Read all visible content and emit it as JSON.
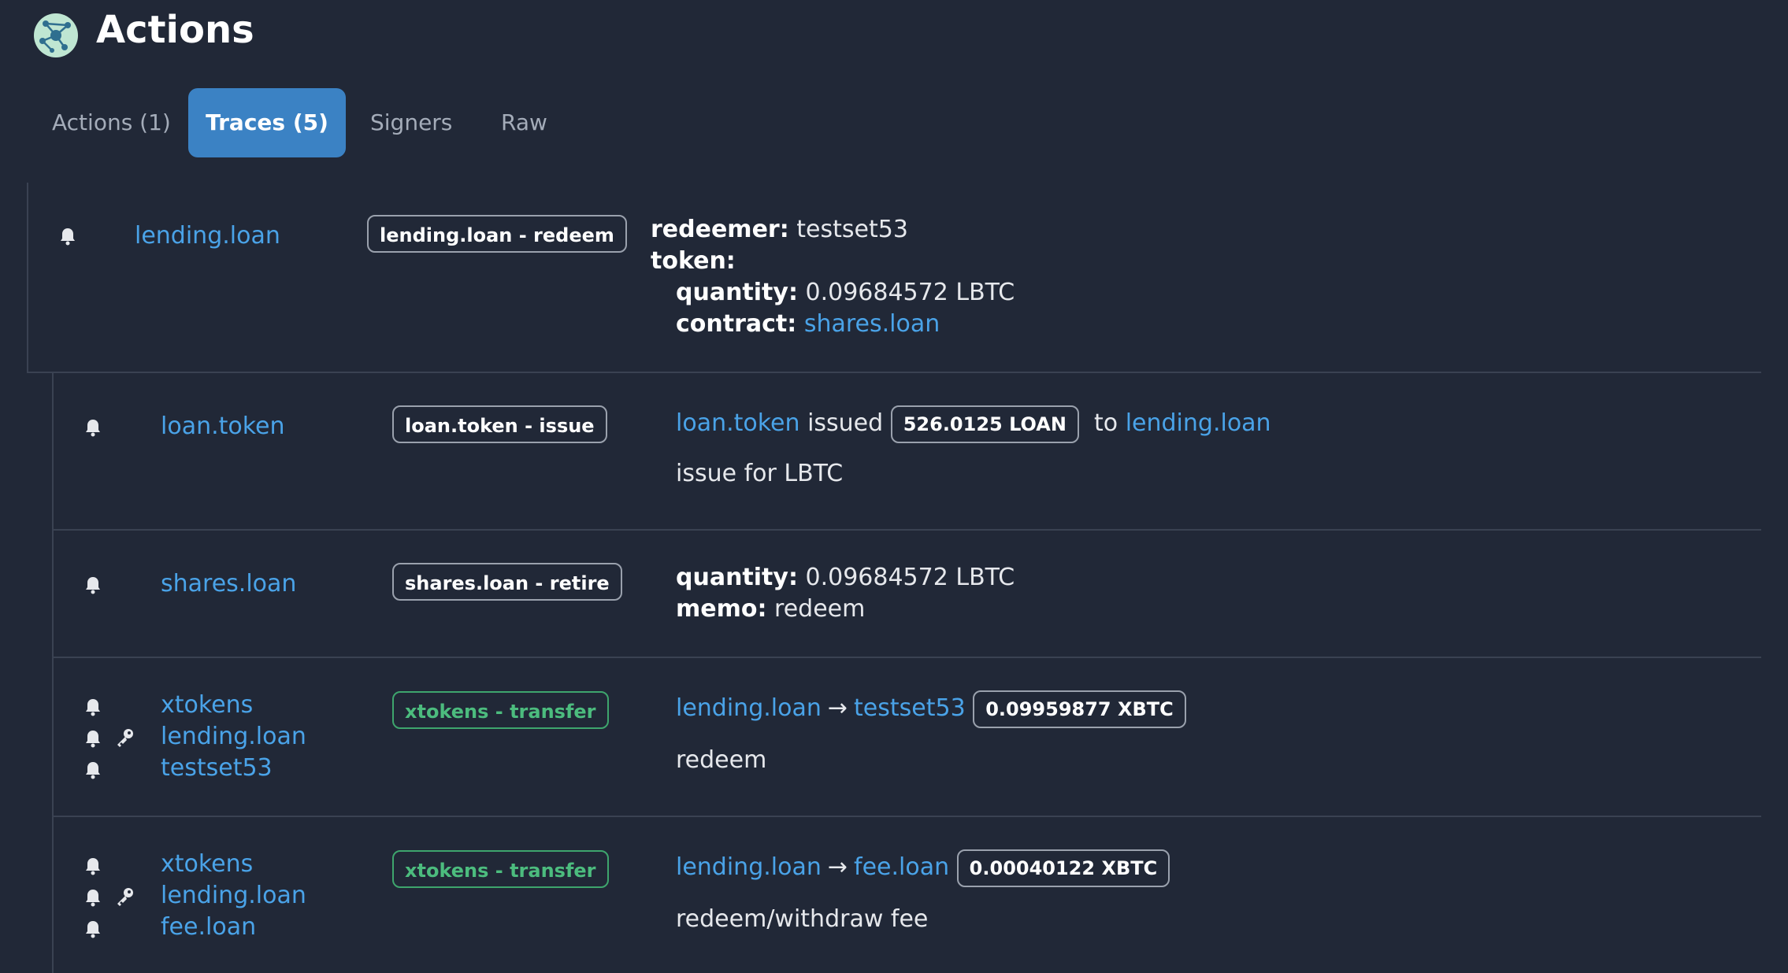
{
  "header": {
    "title": "Actions",
    "logo_icon": "network-logo-icon"
  },
  "tabs": [
    {
      "label": "Actions (1)",
      "active": false
    },
    {
      "label": "Traces (5)",
      "active": true
    },
    {
      "label": "Signers",
      "active": false
    },
    {
      "label": "Raw",
      "active": false
    }
  ],
  "colors": {
    "background": "#212837",
    "accent": "#3b82c4",
    "link": "#4aa3e8",
    "green": "#4cbc7e"
  },
  "traces": [
    {
      "accounts": [
        "lending.loan"
      ],
      "badge": "lending.loan - redeem",
      "fields": {
        "redeemer_label": "redeemer:",
        "redeemer": "testset53",
        "token_label": "token:",
        "quantity_label": "quantity:",
        "quantity": "0.09684572 LBTC",
        "contract_label": "contract:",
        "contract": "shares.loan"
      }
    },
    {
      "accounts": [
        "loan.token"
      ],
      "badge": "loan.token - issue",
      "issuer": "loan.token",
      "verb": "issued",
      "amount": "526.0125 LOAN",
      "to_word": "to",
      "recipient": "lending.loan",
      "memo": "issue for LBTC"
    },
    {
      "accounts": [
        "shares.loan"
      ],
      "badge": "shares.loan - retire",
      "fields": {
        "quantity_label": "quantity:",
        "quantity": "0.09684572 LBTC",
        "memo_label": "memo:",
        "memo": "redeem"
      }
    },
    {
      "accounts": [
        "xtokens",
        "lending.loan",
        "testset53"
      ],
      "badge": "xtokens - transfer",
      "from": "lending.loan",
      "arrow": "→",
      "to": "testset53",
      "amount": "0.09959877 XBTC",
      "memo": "redeem"
    },
    {
      "accounts": [
        "xtokens",
        "lending.loan",
        "fee.loan"
      ],
      "badge": "xtokens - transfer",
      "from": "lending.loan",
      "arrow": "→",
      "to": "fee.loan",
      "amount": "0.00040122 XBTC",
      "memo": "redeem/withdraw fee"
    }
  ]
}
